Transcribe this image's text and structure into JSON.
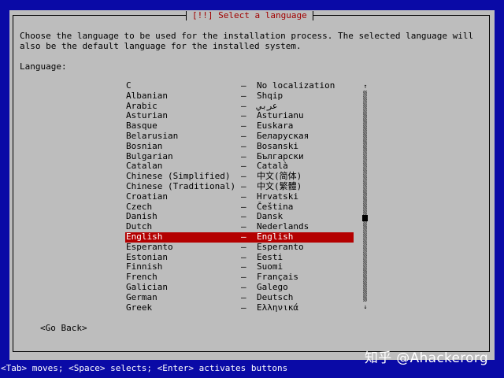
{
  "dialog": {
    "title": "[!!] Select a language",
    "description": "Choose the language to be used for the installation process. The selected language will\nalso be the default language for the installed system.",
    "list_label": "Language:",
    "go_back_label": "<Go Back>"
  },
  "languages": [
    {
      "name": "C",
      "native": "No localization"
    },
    {
      "name": "Albanian",
      "native": "Shqip"
    },
    {
      "name": "Arabic",
      "native": "عربي"
    },
    {
      "name": "Asturian",
      "native": "Asturianu"
    },
    {
      "name": "Basque",
      "native": "Euskara"
    },
    {
      "name": "Belarusian",
      "native": "Беларуская"
    },
    {
      "name": "Bosnian",
      "native": "Bosanski"
    },
    {
      "name": "Bulgarian",
      "native": "Български"
    },
    {
      "name": "Catalan",
      "native": "Català"
    },
    {
      "name": "Chinese (Simplified)",
      "native": "中文(简体)"
    },
    {
      "name": "Chinese (Traditional)",
      "native": "中文(繁體)"
    },
    {
      "name": "Croatian",
      "native": "Hrvatski"
    },
    {
      "name": "Czech",
      "native": "Čeština"
    },
    {
      "name": "Danish",
      "native": "Dansk"
    },
    {
      "name": "Dutch",
      "native": "Nederlands"
    },
    {
      "name": "English",
      "native": "English",
      "selected": true
    },
    {
      "name": "Esperanto",
      "native": "Esperanto"
    },
    {
      "name": "Estonian",
      "native": "Eesti"
    },
    {
      "name": "Finnish",
      "native": "Suomi"
    },
    {
      "name": "French",
      "native": "Français"
    },
    {
      "name": "Galician",
      "native": "Galego"
    },
    {
      "name": "German",
      "native": "Deutsch"
    },
    {
      "name": "Greek",
      "native": "Ελληνικά"
    }
  ],
  "separator": "–",
  "scrollbar": {
    "up_icon": "up-arrow-icon",
    "down_icon": "down-arrow-icon",
    "up_glyph": "↑",
    "down_glyph": "↓"
  },
  "status_bar": "<Tab> moves; <Space> selects; <Enter> activates buttons",
  "watermark": "知乎 @Ahackerorg",
  "colors": {
    "background": "#0a0aa6",
    "dialog": "#bdbdbd",
    "title": "#a00000",
    "selection": "#b40000"
  }
}
